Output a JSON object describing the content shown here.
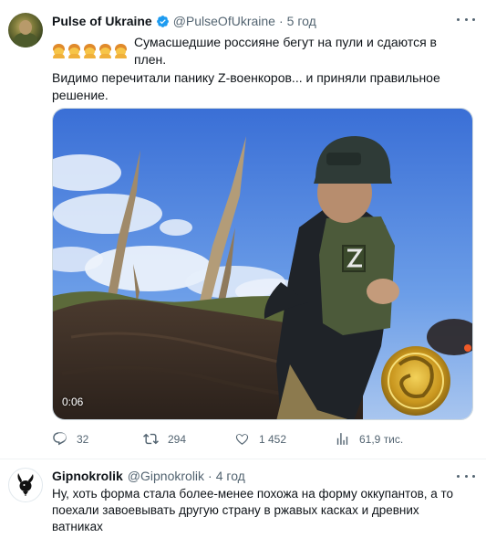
{
  "tweet": {
    "author_name": "Pulse of Ukraine",
    "author_handle": "@PulseOfUkraine",
    "separator": "·",
    "time": "5 год",
    "emoji_count": 5,
    "line1": "Сумасшедшие россияне бегут на пули и сдаются в плен.",
    "line2": "Видимо перечитали панику  Z-военкоров... и приняли правильное решение.",
    "video_duration": "0:06",
    "actions": {
      "replies": "32",
      "retweets": "294",
      "likes": "1 452",
      "views": "61,9 тис."
    }
  },
  "reply": {
    "author_name": "Gipnokrolik",
    "author_handle": "@Gipnokrolik",
    "separator": "·",
    "time": "4 год",
    "text": "Ну, хоть форма стала более-менее похожа на форму оккупантов, а то поехали завоевывать другую страну в ржавых касках и древних ватниках"
  },
  "colors": {
    "text": "#0f1419",
    "muted": "#536471",
    "verified": "#1d9bf0",
    "divider": "#eff3f4"
  },
  "icons": [
    "verified-badge-icon",
    "more-icon",
    "reply-icon",
    "retweet-icon",
    "like-icon",
    "views-icon",
    "playboy-bunny-icon",
    "emoji-person-icon"
  ]
}
